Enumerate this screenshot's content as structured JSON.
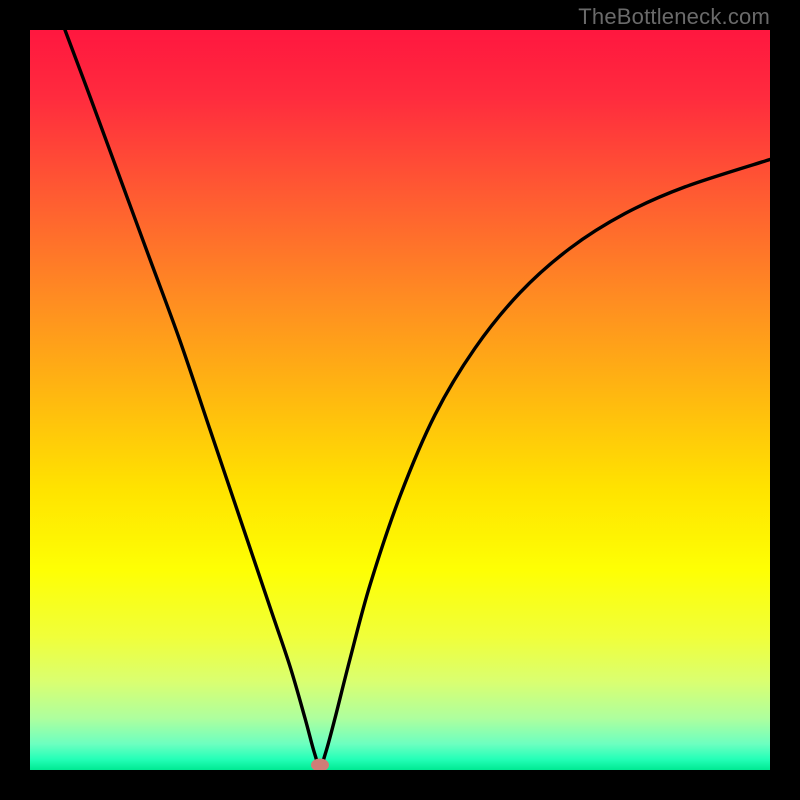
{
  "watermark": "TheBottleneck.com",
  "chart_data": {
    "type": "line",
    "title": "",
    "xlabel": "",
    "ylabel": "",
    "xrange": [
      0,
      740
    ],
    "yrange_percent": [
      0,
      100
    ],
    "background_gradient_stops": [
      {
        "offset": 0,
        "color": "#ff173f"
      },
      {
        "offset": 0.09,
        "color": "#ff2b3e"
      },
      {
        "offset": 0.22,
        "color": "#ff5a32"
      },
      {
        "offset": 0.36,
        "color": "#ff8b22"
      },
      {
        "offset": 0.5,
        "color": "#ffba0f"
      },
      {
        "offset": 0.62,
        "color": "#ffe300"
      },
      {
        "offset": 0.73,
        "color": "#feff04"
      },
      {
        "offset": 0.82,
        "color": "#f0ff3a"
      },
      {
        "offset": 0.88,
        "color": "#daff70"
      },
      {
        "offset": 0.93,
        "color": "#aeff9e"
      },
      {
        "offset": 0.965,
        "color": "#6cffc0"
      },
      {
        "offset": 0.985,
        "color": "#25ffb8"
      },
      {
        "offset": 1.0,
        "color": "#00e992"
      }
    ],
    "series": [
      {
        "name": "bottleneck-curve",
        "note": "y is percent from top (0) to bottom (100); curve dips to 100 at apex then rises",
        "apex_x": 290,
        "points": [
          {
            "x": 35,
            "y": 0
          },
          {
            "x": 60,
            "y": 9
          },
          {
            "x": 90,
            "y": 20
          },
          {
            "x": 120,
            "y": 31
          },
          {
            "x": 150,
            "y": 42
          },
          {
            "x": 180,
            "y": 54
          },
          {
            "x": 210,
            "y": 66
          },
          {
            "x": 240,
            "y": 78
          },
          {
            "x": 260,
            "y": 86
          },
          {
            "x": 275,
            "y": 93
          },
          {
            "x": 284,
            "y": 97.5
          },
          {
            "x": 290,
            "y": 99.5
          },
          {
            "x": 296,
            "y": 97.5
          },
          {
            "x": 305,
            "y": 93
          },
          {
            "x": 320,
            "y": 85
          },
          {
            "x": 340,
            "y": 75
          },
          {
            "x": 370,
            "y": 63
          },
          {
            "x": 405,
            "y": 52
          },
          {
            "x": 445,
            "y": 43
          },
          {
            "x": 490,
            "y": 35.5
          },
          {
            "x": 540,
            "y": 29.5
          },
          {
            "x": 595,
            "y": 24.8
          },
          {
            "x": 655,
            "y": 21.2
          },
          {
            "x": 740,
            "y": 17.5
          }
        ]
      }
    ],
    "apex_marker": {
      "x": 290,
      "y_percent": 99.3,
      "color": "#cf7d77"
    },
    "curve_color": "#000000",
    "curve_width": 3.4
  }
}
